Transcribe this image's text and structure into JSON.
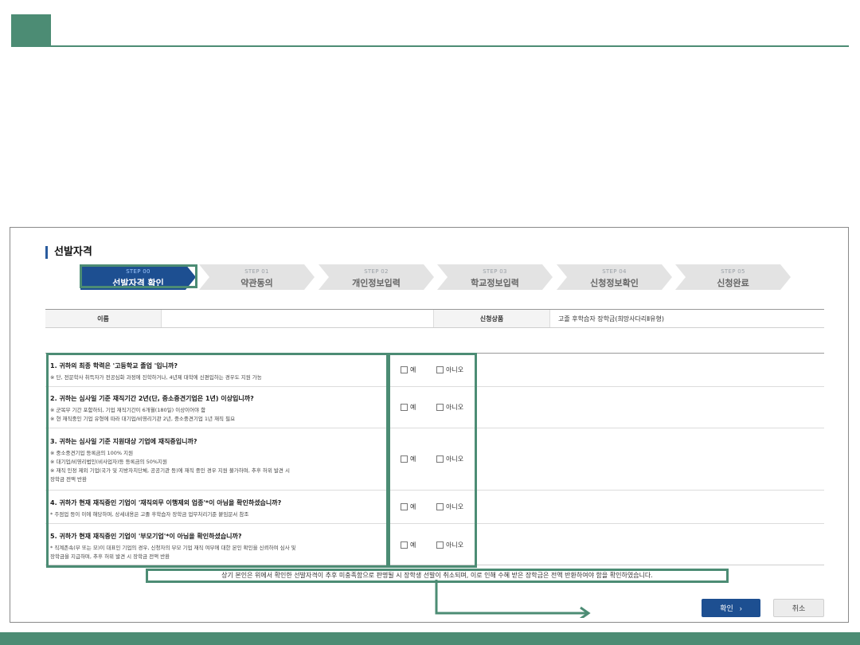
{
  "section_title": "선발자격",
  "steps": [
    {
      "num": "STEP 00",
      "label": "선발자격 확인"
    },
    {
      "num": "STEP 01",
      "label": "약관동의"
    },
    {
      "num": "STEP 02",
      "label": "개인정보입력"
    },
    {
      "num": "STEP 03",
      "label": "학교정보입력"
    },
    {
      "num": "STEP 04",
      "label": "신청정보확인"
    },
    {
      "num": "STEP 05",
      "label": "신청완료"
    }
  ],
  "info": {
    "name_label": "이름",
    "name_value": "",
    "product_label": "신청상품",
    "product_value": "고졸 후학습자 장학금(희망사다리Ⅱ유형)"
  },
  "options": {
    "yes": "예",
    "no": "아니오"
  },
  "questions": [
    {
      "text": "1. 귀하의 최종 학력은 '고등학교 졸업 '입니까?",
      "notes": [
        "※ 단, 전문학사 취득자가 전공심화 과정에 진학하거나, 4년제 대학에 신편입하는 경우도 지원 가능"
      ]
    },
    {
      "text": "2. 귀하는 심사일 기준 재직기간 2년(단, 중소중견기업은 1년) 이상입니까?",
      "notes": [
        "※ 군복무 기간 포함하되, 기업 재직기간이 6개월(180일) 이상이어야 함",
        "※ 현 재직중인 기업 유형에 따라 대기업/비영리기관 2년, 중소중견기업 1년 재직 필요"
      ]
    },
    {
      "text": "3. 귀하는 심사일 기준 지원대상 기업에 재직중입니까?",
      "notes": [
        "※ 중소중견기업 등록금의 100% 지원",
        "※ 대기업/비영리법인(비사업자)등 등록금의 50%지원",
        "※ 재직 인정 제외 기업(국가 및 지방자치단체, 공공기관 등)에 재직 중인 경우 지원 불가하며, 추후 허위 발견 시",
        "장학금 전액 반환"
      ]
    },
    {
      "text": "4. 귀하가 현재 재직중인 기업이 '재직의무 이행제외 업종'*이 아님을 확인하셨습니까?",
      "notes": [
        "* 주점업 등이 이에 해당하며, 상세내용은 고졸 후학습자 장학금 업무처리기준 붙임문서 참조"
      ]
    },
    {
      "text": "5. 귀하가 현재 재직중인 기업이 '부모기업'*이 아님을 확인하셨습니까?",
      "notes": [
        "* 직계존속(부 또는 모)이 대표인 기업의 경우, 신청자의 부모 기업 재직 여부에 대한 본인 확인을 신뢰하여 심사 및",
        "장학금을 지급하며, 추후 허위 발견 시 장학금 전액 반환"
      ]
    }
  ],
  "confirm_note": "상기 본인은 위에서 확인한 선발자격이 추후 미충족함으로 판명될 시 장학생 선발이 취소되며, 이로 인해 수혜 받은 장학금은 전액 반환하여야 함을 확인하였습니다.",
  "buttons": {
    "confirm": "확인",
    "cancel": "취소"
  },
  "colors": {
    "accent": "#4c8c74",
    "primary": "#1d4f91",
    "step_active": "#1d4f91"
  }
}
